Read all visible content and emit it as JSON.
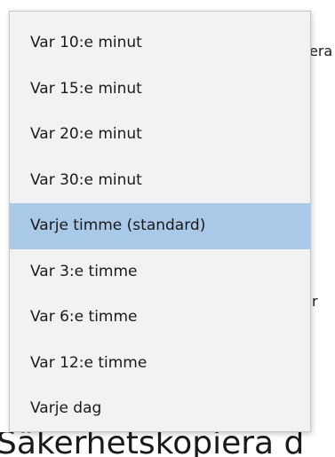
{
  "background": {
    "fragment_right_top": "era",
    "fragment_right_middle": "r",
    "fragment_bottom": "Säkerhetskopiera d"
  },
  "dropdown": {
    "selected_index": 4,
    "options": [
      {
        "label": "Var 10:e minut"
      },
      {
        "label": "Var 15:e minut"
      },
      {
        "label": "Var 20:e minut"
      },
      {
        "label": "Var 30:e minut"
      },
      {
        "label": "Varje timme (standard)"
      },
      {
        "label": "Var 3:e timme"
      },
      {
        "label": "Var 6:e timme"
      },
      {
        "label": "Var 12:e timme"
      },
      {
        "label": "Varje dag"
      }
    ]
  },
  "colors": {
    "selected_background": "#a9c9e8",
    "menu_background": "#f2f2f2",
    "text": "#1a1a1a"
  }
}
